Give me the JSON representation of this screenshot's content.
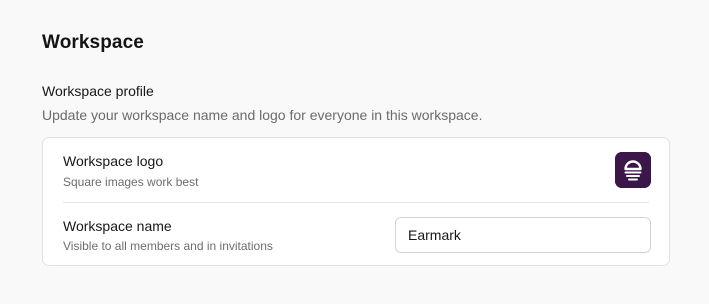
{
  "page": {
    "title": "Workspace"
  },
  "profile": {
    "title": "Workspace profile",
    "description": "Update your workspace name and logo for everyone in this workspace."
  },
  "logo_row": {
    "label": "Workspace logo",
    "hint": "Square images work best",
    "icon": "workspace-logo-sunset-icon",
    "color": "#3b1648"
  },
  "name_row": {
    "label": "Workspace name",
    "hint": "Visible to all members and in invitations",
    "value": "Earmark"
  }
}
